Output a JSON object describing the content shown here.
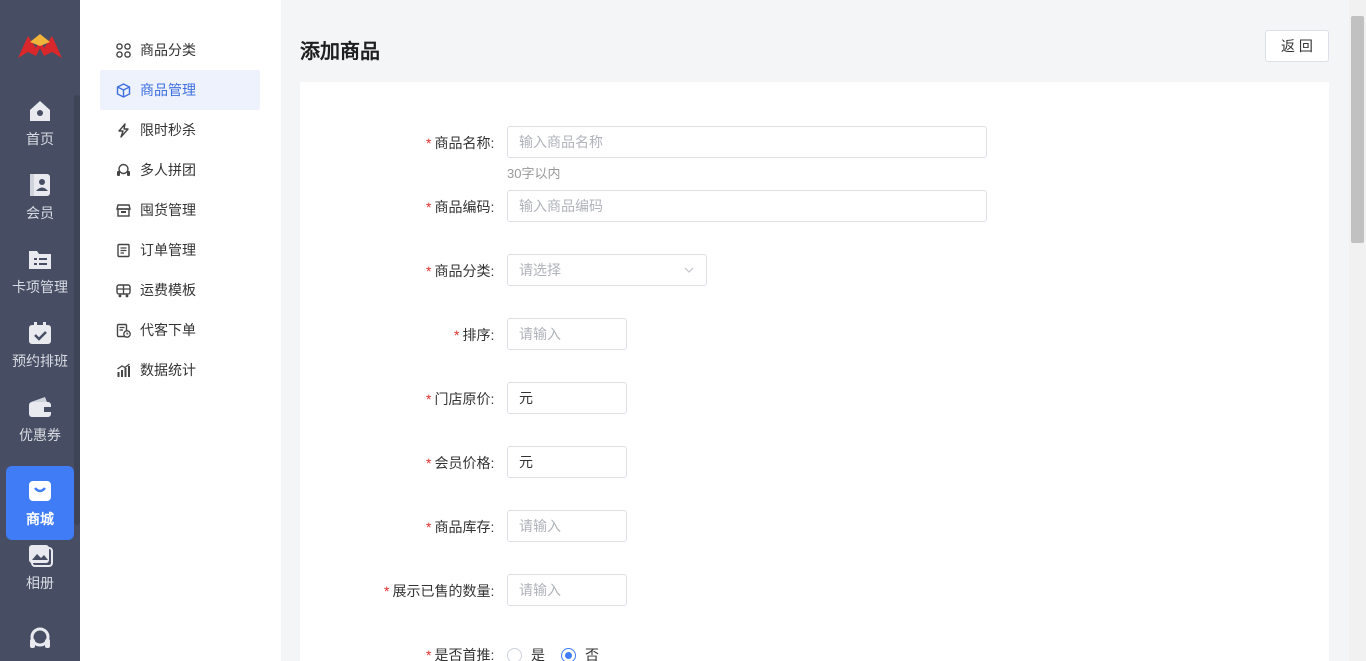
{
  "rail": {
    "items": [
      {
        "label": "首页",
        "icon": "home-icon"
      },
      {
        "label": "会员",
        "icon": "member-card-icon"
      },
      {
        "label": "卡项管理",
        "icon": "folder-list-icon"
      },
      {
        "label": "预约排班",
        "icon": "calendar-check-icon"
      },
      {
        "label": "优惠券",
        "icon": "wallet-icon"
      },
      {
        "label": "商城",
        "icon": "shopping-bag-icon"
      },
      {
        "label": "相册",
        "icon": "album-icon"
      },
      {
        "label": "",
        "icon": "headset-icon"
      }
    ],
    "active_index": 5,
    "active_color": "#3f7cf6"
  },
  "submenu": {
    "items": [
      {
        "label": "商品分类",
        "icon": "grid-icon"
      },
      {
        "label": "商品管理",
        "icon": "box-icon"
      },
      {
        "label": "限时秒杀",
        "icon": "lightning-icon"
      },
      {
        "label": "多人拼团",
        "icon": "group-icon"
      },
      {
        "label": "囤货管理",
        "icon": "store-icon"
      },
      {
        "label": "订单管理",
        "icon": "order-icon"
      },
      {
        "label": "运费模板",
        "icon": "truck-icon"
      },
      {
        "label": "代客下单",
        "icon": "proxy-order-icon"
      },
      {
        "label": "数据统计",
        "icon": "stats-icon"
      }
    ],
    "active_index": 1
  },
  "header": {
    "title": "添加商品",
    "back_label": "返 回"
  },
  "form": {
    "name": {
      "label": "商品名称:",
      "placeholder": "输入商品名称",
      "hint": "30字以内"
    },
    "code": {
      "label": "商品编码:",
      "placeholder": "输入商品编码"
    },
    "category": {
      "label": "商品分类:",
      "placeholder": "请选择"
    },
    "sort": {
      "label": "排序:",
      "placeholder": "请输入"
    },
    "store_price": {
      "label": "门店原价:",
      "value": "元"
    },
    "member_price": {
      "label": "会员价格:",
      "value": "元"
    },
    "stock": {
      "label": "商品库存:",
      "placeholder": "请输入"
    },
    "sold_count": {
      "label": "展示已售的数量:",
      "placeholder": "请输入"
    },
    "homepage": {
      "label": "是否首推:",
      "options": [
        "是",
        "否"
      ],
      "selected": "否"
    }
  }
}
